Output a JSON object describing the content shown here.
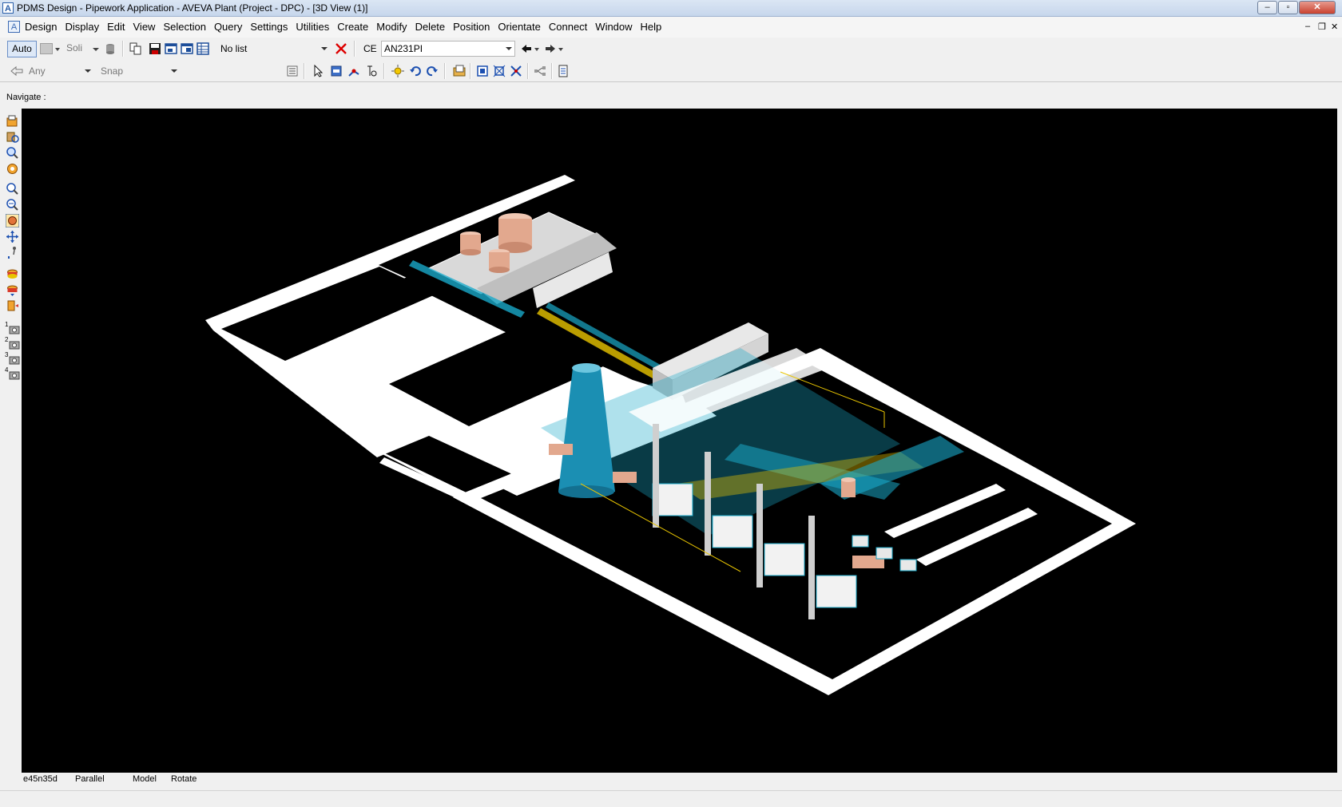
{
  "window": {
    "title": "PDMS Design - Pipework Application -  AVEVA Plant (Project - DPC) - [3D View (1)]",
    "minimize": "‒",
    "maximize": "▫",
    "close": "✕"
  },
  "menubar": {
    "items": [
      "Design",
      "Display",
      "Edit",
      "View",
      "Selection",
      "Query",
      "Settings",
      "Utilities",
      "Create",
      "Modify",
      "Delete",
      "Position",
      "Orientate",
      "Connect",
      "Window",
      "Help"
    ],
    "mdi_min": "–",
    "mdi_restore": "❐",
    "mdi_close": "✕"
  },
  "toolbar1": {
    "auto_label": "Auto",
    "solid_label": "Soli",
    "list_value": "No list",
    "ce_label": "CE",
    "ce_value": "AN231PI"
  },
  "toolbar2": {
    "any_value": "Any",
    "snap_value": "Snap"
  },
  "navigate_label": "Navigate :",
  "left_toolbar": {
    "view_labels": [
      "1",
      "2",
      "3",
      "4"
    ]
  },
  "status": {
    "direction": "e45n35d",
    "projection": "Parallel",
    "mode": "Model",
    "action": "Rotate"
  },
  "colors": {
    "viewport_bg": "#000000",
    "road": "#ffffff",
    "pipe_cyan": "#19a9c9",
    "pipe_yellow": "#e8c400",
    "tank": "#e2a88e",
    "stack": "#1b8fb3"
  }
}
